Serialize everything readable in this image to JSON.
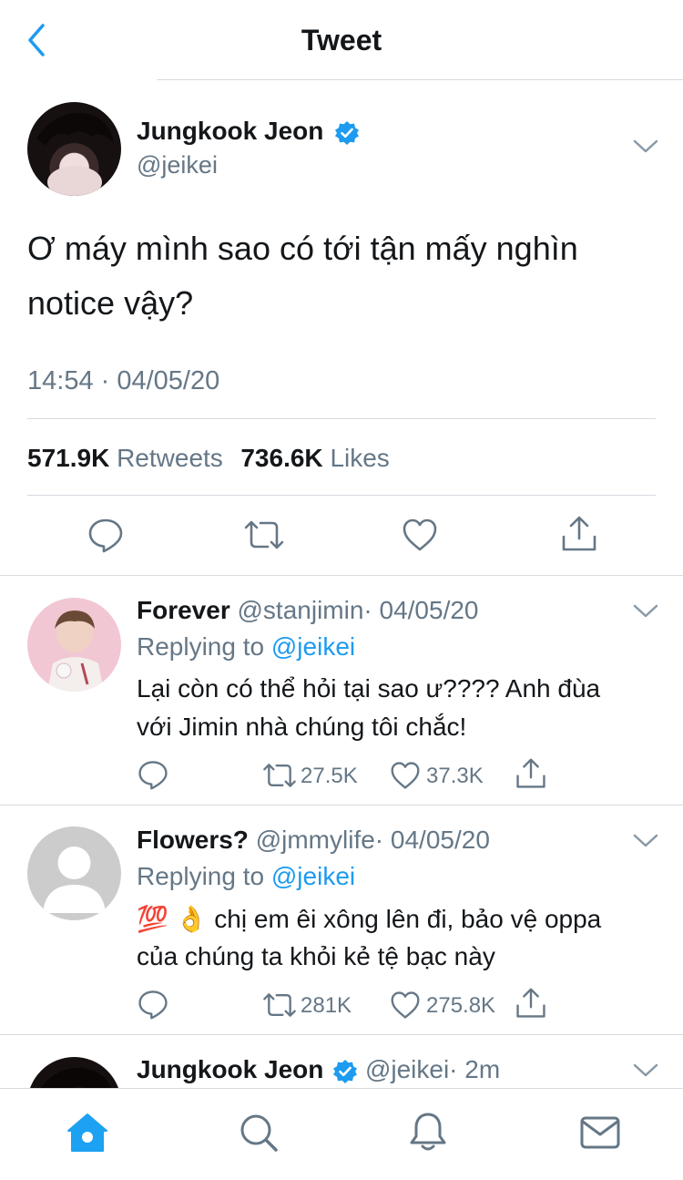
{
  "header": {
    "title": "Tweet"
  },
  "main_tweet": {
    "name": "Jungkook Jeon",
    "handle": "@jeikei",
    "text_line1": "Ơ máy mình sao có tới tận mấy nghìn",
    "text_line2": "notice vậy?",
    "timestamp": "14:54 · 04/05/20",
    "retweets_count": "571.9K",
    "retweets_label": "Retweets",
    "likes_count": "736.6K",
    "likes_label": "Likes"
  },
  "replies": [
    {
      "name": "Forever",
      "handle": "@stanjimin",
      "date": "· 04/05/20",
      "replying_label": "Replying to",
      "replying_to": "@jeikei",
      "text_line1": "Lại còn có thể hỏi tại sao ư???? Anh đùa",
      "text_line2": "với Jimin nhà chúng tôi chắc!",
      "retweets": "27.5K",
      "likes": "37.3K"
    },
    {
      "name": "Flowers?",
      "handle": "@jmmylife",
      "date": "· 04/05/20",
      "replying_label": "Replying to",
      "replying_to": "@jeikei",
      "emoji": "💯 👌",
      "text_line1": "chị em êi xông lên đi, bảo vệ oppa",
      "text_line2": "của chúng ta khỏi kẻ tệ bạc này",
      "retweets": "281K",
      "likes": "275.8K"
    },
    {
      "name": "Jungkook Jeon",
      "handle": "@jeikei",
      "date": "· 2m"
    }
  ],
  "tabbar": {
    "items": [
      "home-icon",
      "search-icon",
      "notifications-icon",
      "messages-icon"
    ],
    "active": "home-icon"
  },
  "colors": {
    "accent": "#1d9bf0",
    "text": "#14171a",
    "secondary": "#657786",
    "divider": "#d6dbe0",
    "tab_active": "#1da1f2"
  }
}
